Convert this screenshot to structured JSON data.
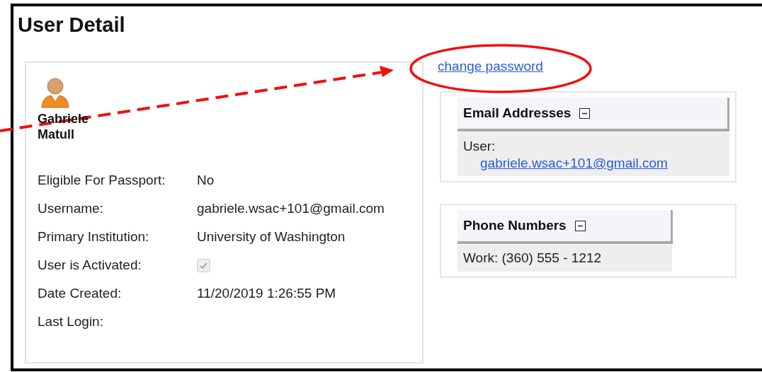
{
  "page": {
    "title": "User Detail"
  },
  "user": {
    "first_name": "Gabriele",
    "last_name": "Matull"
  },
  "fields": [
    {
      "kind": "text",
      "label": "Eligible For Passport:",
      "value": "No"
    },
    {
      "kind": "text",
      "label": "Username:",
      "value": "gabriele.wsac+101@gmail.com"
    },
    {
      "kind": "text",
      "label": "Primary Institution:",
      "value": "University of Washington"
    },
    {
      "kind": "checkbox",
      "label": "User is Activated:",
      "checked": true,
      "disabled": true
    },
    {
      "kind": "text",
      "label": "Date Created:",
      "value": "11/20/2019 1:26:55 PM"
    },
    {
      "kind": "text",
      "label": "Last Login:"
    }
  ],
  "change_password_link": "change password",
  "email_panel": {
    "title": "Email Addresses",
    "expanded": true,
    "entries": [
      {
        "label": "User:",
        "email": "gabriele.wsac+101@gmail.com"
      }
    ]
  },
  "phone_panel": {
    "title": "Phone Numbers",
    "expanded": true,
    "entries": [
      {
        "text": "Work: (360) 555 - 1212"
      }
    ]
  }
}
